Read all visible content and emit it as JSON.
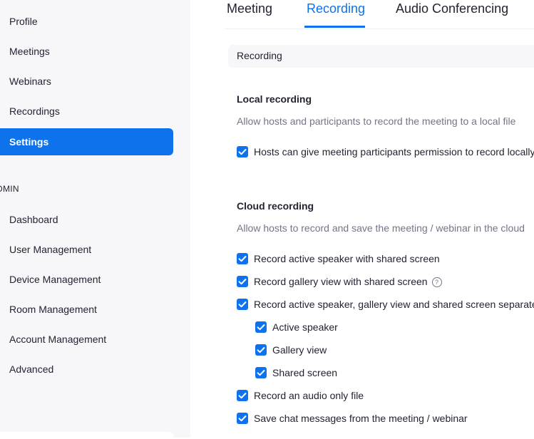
{
  "sidebar": {
    "items": [
      {
        "label": "Profile"
      },
      {
        "label": "Meetings"
      },
      {
        "label": "Webinars"
      },
      {
        "label": "Recordings"
      },
      {
        "label": "Settings"
      }
    ],
    "admin_heading": "DMIN",
    "admin_items": [
      {
        "label": "Dashboard"
      },
      {
        "label": "User Management"
      },
      {
        "label": "Device Management"
      },
      {
        "label": "Room Management"
      },
      {
        "label": "Account Management"
      },
      {
        "label": "Advanced"
      }
    ]
  },
  "tabs": [
    {
      "label": "Meeting"
    },
    {
      "label": "Recording"
    },
    {
      "label": "Audio Conferencing"
    }
  ],
  "section_bar": {
    "label": "Recording"
  },
  "local_recording": {
    "heading": "Local recording",
    "description": "Allow hosts and participants to record the meeting to a local file",
    "options": [
      {
        "label": "Hosts can give meeting participants permission to record locally",
        "checked": true
      }
    ]
  },
  "cloud_recording": {
    "heading": "Cloud recording",
    "description": "Allow hosts to record and save the meeting / webinar in the cloud",
    "options": [
      {
        "label": "Record active speaker with shared screen",
        "checked": true
      },
      {
        "label": "Record gallery view with shared screen",
        "checked": true,
        "help_icon": "?"
      },
      {
        "label": "Record active speaker, gallery view and shared screen separately",
        "checked": true
      },
      {
        "label": "Active speaker",
        "checked": true
      },
      {
        "label": "Gallery view",
        "checked": true
      },
      {
        "label": "Shared screen",
        "checked": true
      },
      {
        "label": "Record an audio only file",
        "checked": true
      },
      {
        "label": "Save chat messages from the meeting / webinar",
        "checked": true
      }
    ]
  },
  "colors": {
    "accent": "#0e72ed",
    "sidebar_bg": "#f7f7fa",
    "muted_text": "#747487"
  },
  "icons": {
    "checkbox": "check-icon",
    "help": "question-circle-icon"
  }
}
